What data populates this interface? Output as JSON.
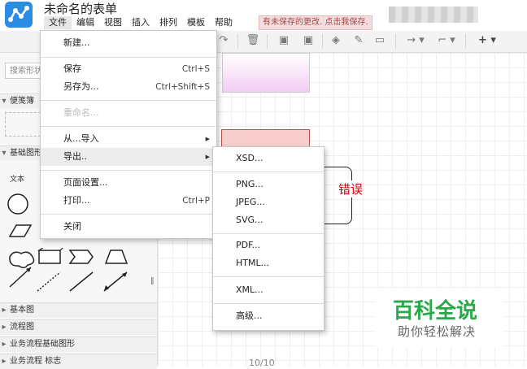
{
  "app": {
    "title": "未命名的表单",
    "menus": [
      "文件",
      "编辑",
      "视图",
      "插入",
      "排列",
      "模板",
      "帮助"
    ],
    "unsaved_notice": "有未保存的更改. 点击我保存."
  },
  "sidebar": {
    "search_placeholder": "搜索形状",
    "sections_top": [
      {
        "label": "便笺簿",
        "arrow": "▾"
      },
      {
        "label": "基础图形",
        "arrow": "▾"
      }
    ],
    "text_shape_label": "文本",
    "sections_bottom": [
      {
        "label": "基本图",
        "arrow": "▸"
      },
      {
        "label": "流程图",
        "arrow": "▸"
      },
      {
        "label": "业务流程基础图形",
        "arrow": "▸"
      },
      {
        "label": "业务流程 标志",
        "arrow": "▸"
      }
    ],
    "grip": "‖"
  },
  "canvas": {
    "error_label": "错误",
    "page_count": "10/10"
  },
  "file_menu": {
    "items": [
      {
        "label": "新建...",
        "shortcut": ""
      },
      {
        "label": "保存",
        "shortcut": "Ctrl+S"
      },
      {
        "label": "另存为...",
        "shortcut": "Ctrl+Shift+S"
      },
      {
        "label": "重命名...",
        "shortcut": "",
        "disabled": true
      },
      {
        "label": "从...导入",
        "shortcut": "",
        "submenu": "▶"
      },
      {
        "label": "导出..",
        "shortcut": "",
        "submenu": "▶",
        "highlighted": true
      },
      {
        "label": "页面设置...",
        "shortcut": ""
      },
      {
        "label": "打印...",
        "shortcut": "Ctrl+P"
      },
      {
        "label": "关闭",
        "shortcut": ""
      }
    ]
  },
  "export_menu": {
    "items": [
      "XSD...",
      "PNG...",
      "JPEG...",
      "SVG...",
      "PDF...",
      "HTML...",
      "XML...",
      "高级..."
    ]
  },
  "watermark": {
    "title": "百科全说",
    "subtitle": "助你轻松解决"
  },
  "colors": {
    "brand": "#2c8be3",
    "error_text": "#cc0000",
    "watermark_green": "#2aa84a",
    "red_shape_fill": "#f8cecc",
    "pink_shape_fill": "#f3cdf3"
  }
}
